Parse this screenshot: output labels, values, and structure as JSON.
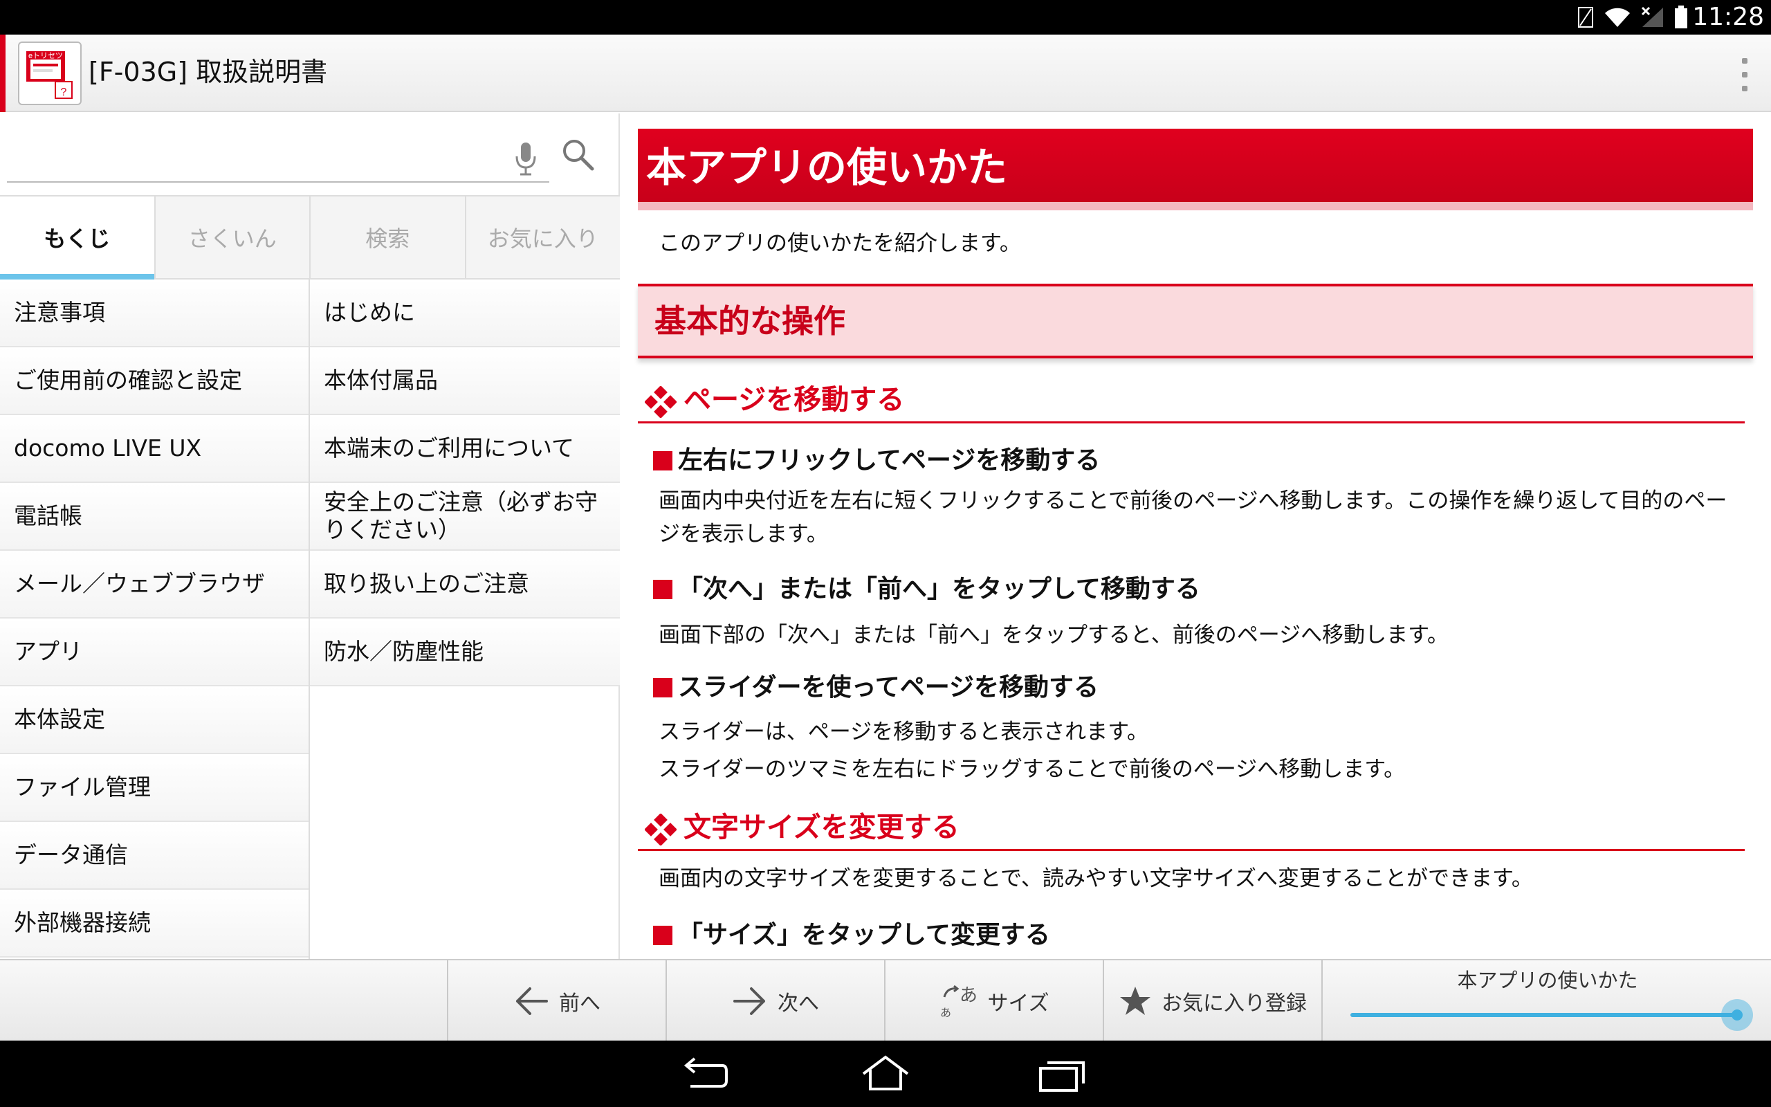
{
  "status_bar": {
    "time": "11:28"
  },
  "action_bar": {
    "title": "[F-03G] 取扱説明書"
  },
  "search": {
    "placeholder": "",
    "value": ""
  },
  "tabs": [
    {
      "label": "もくじ",
      "active": true
    },
    {
      "label": "さくいん",
      "active": false
    },
    {
      "label": "検索",
      "active": false
    },
    {
      "label": "お気に入り",
      "active": false
    }
  ],
  "toc": {
    "left": [
      "注意事項",
      "ご使用前の確認と設定",
      "docomo LIVE UX",
      "電話帳",
      "メール／ウェブブラウザ",
      "アプリ",
      "本体設定",
      "ファイル管理",
      "データ通信",
      "外部機器接続"
    ],
    "right": [
      "はじめに",
      "本体付属品",
      "本端末のご利用について",
      "安全上のご注意（必ずお守りください）",
      "取り扱い上のご注意",
      "防水／防塵性能"
    ]
  },
  "content": {
    "page_title": "本アプリの使いかた",
    "intro": "このアプリの使いかたを紹介します。",
    "section_title": "基本的な操作",
    "sub1_title": "ページを移動する",
    "item1_title": "左右にフリックしてページを移動する",
    "item1_text": "画面内中央付近を左右に短くフリックすることで前後のページへ移動します。この操作を繰り返して目的のページを表示します。",
    "item2_title": "「次へ」または「前へ」をタップして移動する",
    "item2_text": "画面下部の「次へ」または「前へ」をタップすると、前後のページへ移動します。",
    "item3_title": "スライダーを使ってページを移動する",
    "item3_text1": "スライダーは、ページを移動すると表示されます。",
    "item3_text2": "スライダーのツマミを左右にドラッグすることで前後のページへ移動します。",
    "sub2_title": "文字サイズを変更する",
    "sub2_text": "画面内の文字サイズを変更することで、読みやすい文字サイズへ変更することができます。",
    "item4_title": "「サイズ」をタップして変更する"
  },
  "toolbar": {
    "prev_label": "前へ",
    "next_label": "次へ",
    "size_label": "サイズ",
    "favorite_label": "お気に入り登録",
    "slider_label": "本アプリの使いかた",
    "slider_position": 1.0
  },
  "colors": {
    "accent_red": "#d9001b",
    "header_band": "#fadadd",
    "slider_blue": "#3fb0e0",
    "tab_indicator": "#6cc4ea"
  },
  "icons": [
    "battery-icon",
    "wifi-icon",
    "signal-icon",
    "mic-icon",
    "search-icon",
    "overflow-menu-icon",
    "arrow-left-icon",
    "arrow-right-icon",
    "text-size-icon",
    "star-icon",
    "back-icon",
    "home-icon",
    "recents-icon"
  ]
}
